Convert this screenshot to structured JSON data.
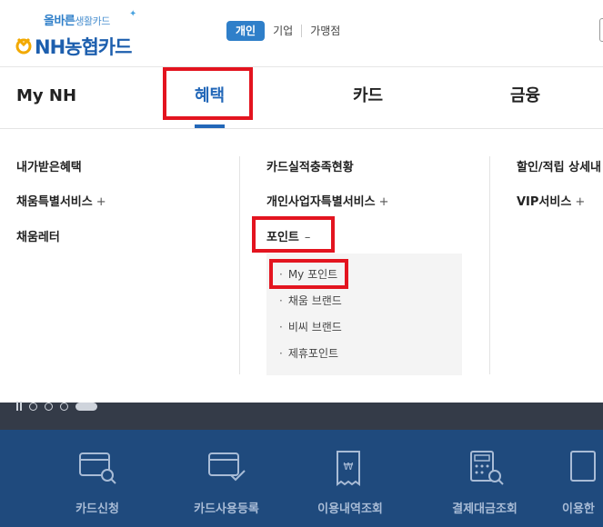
{
  "header": {
    "tagline": "올바른",
    "tagline_sub": "생활카드",
    "brand": "NH농협카드",
    "user_tabs": [
      "개인",
      "기업",
      "가맹점"
    ]
  },
  "nav": {
    "items": [
      "My NH",
      "혜택",
      "카드",
      "금융"
    ],
    "active": "혜택"
  },
  "mega_menu": {
    "col1": [
      "내가받은혜택",
      "채움특별서비스",
      "채움레터"
    ],
    "col2": [
      "카드실적충족현황",
      "개인사업자특별서비스",
      "포인트"
    ],
    "col3": [
      "할인/적립 상세내",
      "VIP서비스"
    ],
    "expand_symbol": "+",
    "collapse_symbol": "–",
    "point_submenu": [
      "My 포인트",
      "채움 브랜드",
      "비씨 브랜드",
      "제휴포인트"
    ],
    "bullet": "·"
  },
  "quick_menu": {
    "items": [
      "카드신청",
      "카드사용등록",
      "이용내역조회",
      "결제대금조회",
      "이용한"
    ]
  },
  "colors": {
    "brand_blue": "#2267b8",
    "highlight_red": "#e3141f",
    "quick_bg": "#1f4a7d",
    "quick_text": "#a9bcd6"
  }
}
